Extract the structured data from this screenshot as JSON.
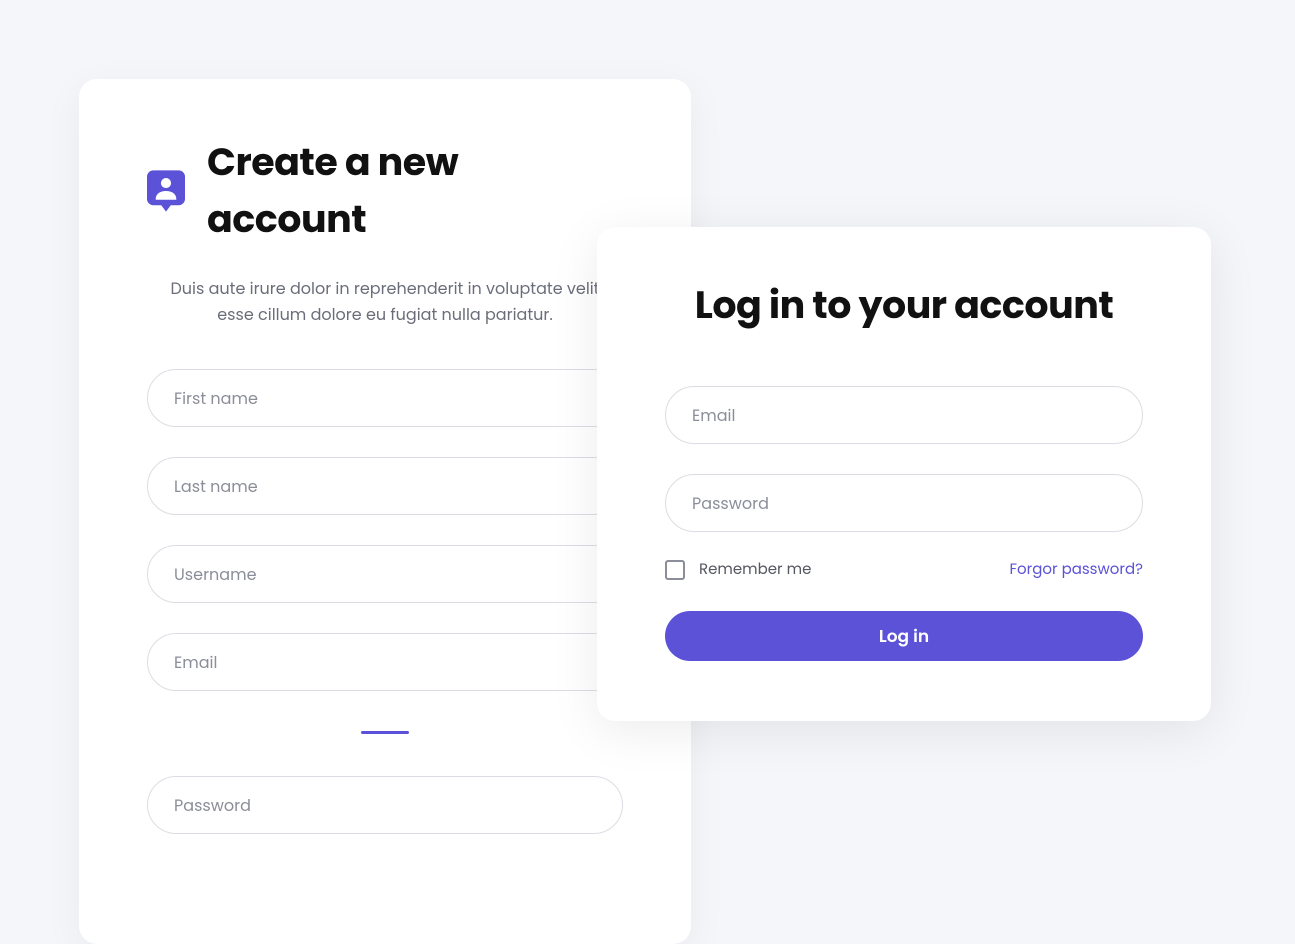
{
  "signup": {
    "title": "Create a new account",
    "subtitle": "Duis aute irure dolor in reprehenderit in voluptate velit esse cillum dolore eu fugiat nulla pariatur.",
    "fields": {
      "first_name_placeholder": "First name",
      "last_name_placeholder": "Last name",
      "username_placeholder": "Username",
      "email_placeholder": "Email",
      "password_placeholder": "Password"
    }
  },
  "login": {
    "title": "Log in to your account",
    "email_placeholder": "Email",
    "password_placeholder": "Password",
    "remember_label": "Remember me",
    "forgot_label": "Forgor password?",
    "button_label": "Log in"
  },
  "colors": {
    "accent": "#5b52d8"
  }
}
